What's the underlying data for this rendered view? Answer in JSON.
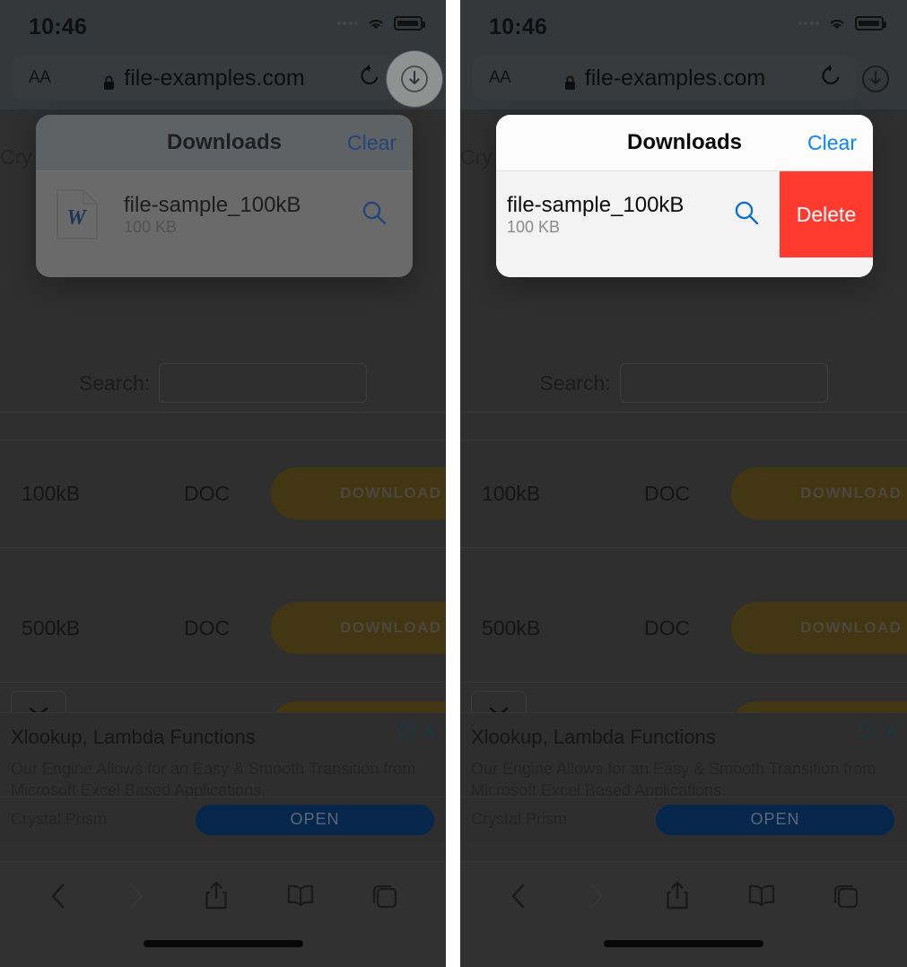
{
  "status_bar": {
    "time": "10:46",
    "wifi_icon": "wifi-icon",
    "battery_icon": "battery-icon",
    "signal_icon": "cellular-dots-icon"
  },
  "browser": {
    "text_size_label": "AA",
    "lock_icon": "lock-icon",
    "url": "file-examples.com",
    "reload_icon": "reload-icon",
    "downloads_icon": "downloads-arrow-icon"
  },
  "downloads_popup": {
    "title": "Downloads",
    "clear_label": "Clear",
    "item": {
      "file_icon": "word-document-icon",
      "file_icon_letter": "W",
      "name": "file-sample_100kB",
      "size": "100 KB",
      "search_icon": "magnifier-icon"
    },
    "delete_label": "Delete"
  },
  "website": {
    "breadcrumb_fragment": "Cry",
    "search_label": "Search:",
    "search_value": "",
    "search_placeholder": "",
    "rows": [
      {
        "size": "100kB",
        "type": "DOC",
        "button": "DOWNLOAD SA"
      },
      {
        "size": "500kB",
        "type": "DOC",
        "button": "DOWNLOAD SA"
      }
    ],
    "select_icon": "chevron-down-icon"
  },
  "ad": {
    "title": "Xlookup, Lambda Functions",
    "body": "Our Engine Allows for an Easy & Smooth Transition from Microsoft Excel Based Applications.",
    "advertiser": "Crystal Prism",
    "open_label": "OPEN",
    "info_icon": "info-icon",
    "close_icon": "close-icon"
  },
  "toolbar": {
    "back_icon": "back-chevron-icon",
    "forward_icon": "forward-chevron-icon",
    "share_icon": "share-icon",
    "bookmarks_icon": "book-icon",
    "tabs_icon": "tabs-icon"
  },
  "colors": {
    "delete_red": "#ff3b30",
    "link_blue": "#0a84ff",
    "ad_open_blue": "#0b3f7a",
    "download_pill": "#6d5a1f"
  }
}
